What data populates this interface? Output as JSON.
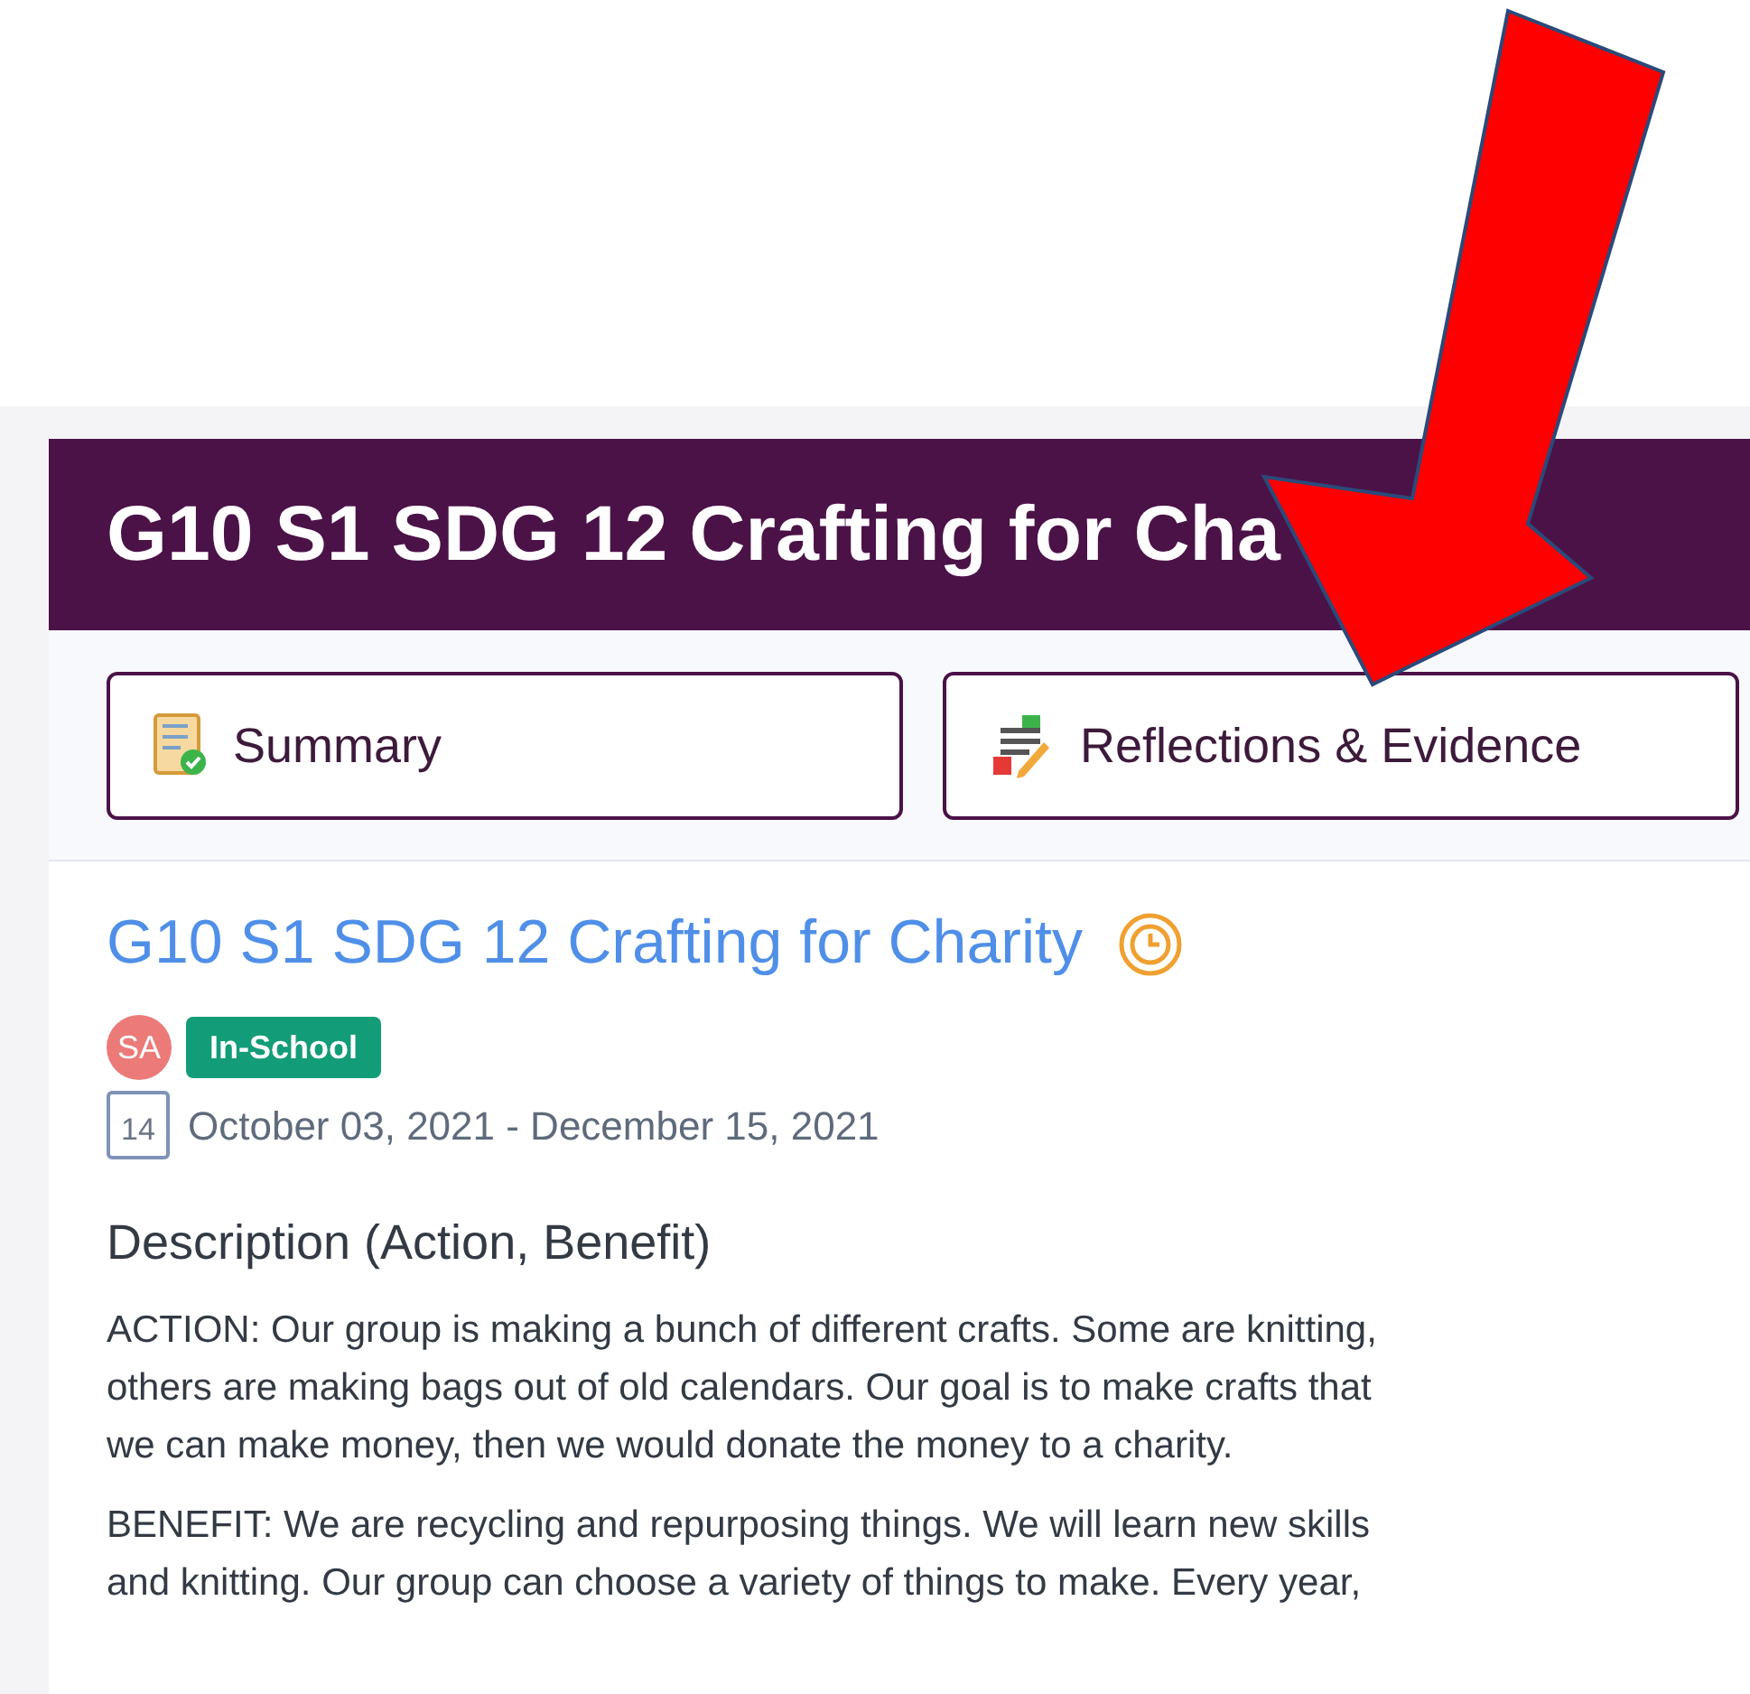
{
  "header": {
    "title": "G10 S1 SDG 12 Crafting for Cha"
  },
  "tabs": [
    {
      "label": "Summary"
    },
    {
      "label": "Reflections & Evidence"
    }
  ],
  "experience": {
    "title": "G10 S1 SDG 12 Crafting for Charity",
    "avatar": "SA",
    "badge": "In-School",
    "calendar_day": "14",
    "dates": "October 03, 2021 - December 15, 2021"
  },
  "description": {
    "heading": "Description (Action, Benefit)",
    "paragraphs": [
      [
        "ACTION: Our group is making a bunch of different crafts. Some are knitting,",
        "others are making bags out of old calendars. Our goal is to make crafts that",
        "we can make money, then we would donate the money to a charity."
      ],
      [
        "BENEFIT: We are recycling and repurposing things. We will learn new skills",
        "and knitting. Our group can choose a variety of things to make. Every year,"
      ]
    ]
  }
}
